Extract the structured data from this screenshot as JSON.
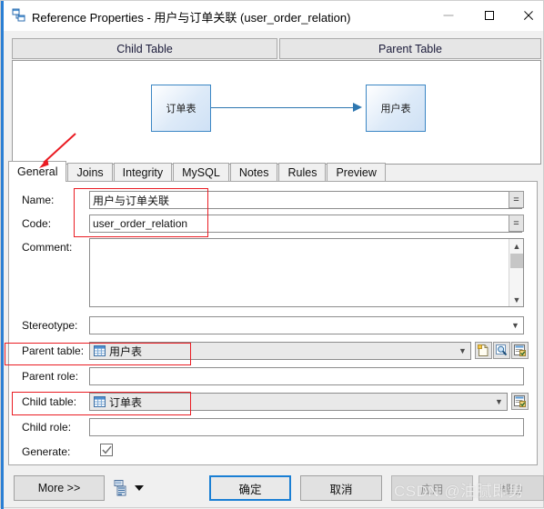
{
  "window": {
    "title": "Reference Properties - 用户与订单关联 (user_order_relation)",
    "icon": "reference-properties-icon",
    "controls": {
      "minimize": "minimize-icon",
      "maximize": "maximize-icon",
      "close": "close-icon"
    }
  },
  "diagram": {
    "headers": {
      "child": "Child Table",
      "parent": "Parent Table"
    },
    "child_node": "订单表",
    "parent_node": "用户表",
    "link": "reference-arrow"
  },
  "tabs": [
    {
      "label": "General",
      "active": true
    },
    {
      "label": "Joins",
      "active": false
    },
    {
      "label": "Integrity",
      "active": false
    },
    {
      "label": "MySQL",
      "active": false
    },
    {
      "label": "Notes",
      "active": false
    },
    {
      "label": "Rules",
      "active": false
    },
    {
      "label": "Preview",
      "active": false
    }
  ],
  "form": {
    "name": {
      "label": "Name:",
      "value": "用户与订单关联",
      "equals_button": "="
    },
    "code": {
      "label": "Code:",
      "value": "user_order_relation",
      "equals_button": "="
    },
    "comment": {
      "label": "Comment:",
      "value": "",
      "placeholder": ""
    },
    "stereotype": {
      "label": "Stereotype:",
      "value": ""
    },
    "parent_table": {
      "label": "Parent table:",
      "value": "用户表",
      "icon": "table-icon"
    },
    "parent_role": {
      "label": "Parent role:",
      "value": ""
    },
    "child_table": {
      "label": "Child table:",
      "value": "订单表",
      "icon": "table-icon"
    },
    "child_role": {
      "label": "Child role:",
      "value": ""
    },
    "generate": {
      "label": "Generate:",
      "checked": true
    }
  },
  "footer": {
    "more": "More >>",
    "report_icon": "report-icon",
    "report_dropdown": "chevron-down-icon",
    "ok": "确定",
    "cancel": "取消",
    "apply": "应用",
    "help": "帮助"
  },
  "annotations": {
    "watermark": "CSDN @油腻即男",
    "arrow_to_general": "red-arrow-annotation",
    "rect_name_code": "red-rect-annotation",
    "rect_parent_table": "red-rect-annotation",
    "rect_child_table": "red-rect-annotation"
  },
  "colors": {
    "accent": "#2b7fd4",
    "annotation": "#ea1c23",
    "node_border": "#3b86c4"
  }
}
